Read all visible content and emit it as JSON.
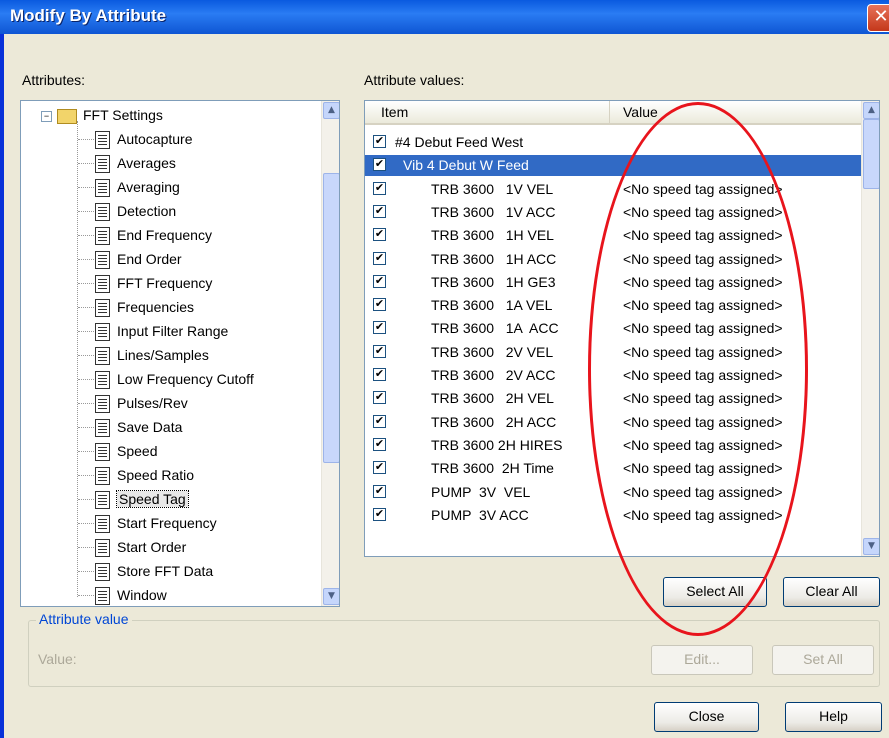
{
  "window": {
    "title": "Modify By Attribute",
    "close_glyph": "✕"
  },
  "labels": {
    "attributes": "Attributes:",
    "attribute_values": "Attribute values:"
  },
  "tree": {
    "root": "FFT Settings",
    "items": [
      "Autocapture",
      "Averages",
      "Averaging",
      "Detection",
      "End Frequency",
      "End Order",
      "FFT Frequency",
      "Frequencies",
      "Input Filter Range",
      "Lines/Samples",
      "Low Frequency Cutoff",
      "Pulses/Rev",
      "Save Data",
      "Speed",
      "Speed Ratio",
      "Speed Tag",
      "Start Frequency",
      "Start Order",
      "Store FFT Data",
      "Window"
    ],
    "selected": "Speed Tag"
  },
  "list": {
    "columns": {
      "item": "Item",
      "value": "Value"
    },
    "rows": [
      {
        "item": "#4 Debut Feed West",
        "value": "",
        "indent": 0
      },
      {
        "item": "Vib 4 Debut W Feed",
        "value": "",
        "indent": 1,
        "highlighted": true
      },
      {
        "item": "TRB 3600   1V VEL",
        "value": "<No speed tag assigned>",
        "indent": 2
      },
      {
        "item": "TRB 3600   1V ACC",
        "value": "<No speed tag assigned>",
        "indent": 2
      },
      {
        "item": "TRB 3600   1H VEL",
        "value": "<No speed tag assigned>",
        "indent": 2
      },
      {
        "item": "TRB 3600   1H ACC",
        "value": "<No speed tag assigned>",
        "indent": 2
      },
      {
        "item": "TRB 3600   1H GE3",
        "value": "<No speed tag assigned>",
        "indent": 2
      },
      {
        "item": "TRB 3600   1A VEL",
        "value": "<No speed tag assigned>",
        "indent": 2
      },
      {
        "item": "TRB 3600   1A  ACC",
        "value": "<No speed tag assigned>",
        "indent": 2
      },
      {
        "item": "TRB 3600   2V VEL",
        "value": "<No speed tag assigned>",
        "indent": 2
      },
      {
        "item": "TRB 3600   2V ACC",
        "value": "<No speed tag assigned>",
        "indent": 2
      },
      {
        "item": "TRB 3600   2H VEL",
        "value": "<No speed tag assigned>",
        "indent": 2
      },
      {
        "item": "TRB 3600   2H ACC",
        "value": "<No speed tag assigned>",
        "indent": 2
      },
      {
        "item": "TRB 3600 2H HIRES",
        "value": "<No speed tag assigned>",
        "indent": 2
      },
      {
        "item": "TRB 3600  2H Time",
        "value": "<No speed tag assigned>",
        "indent": 2
      },
      {
        "item": "PUMP  3V  VEL",
        "value": "<No speed tag assigned>",
        "indent": 2
      },
      {
        "item": "PUMP  3V ACC",
        "value": "<No speed tag assigned>",
        "indent": 2
      }
    ],
    "check_glyph": "✔"
  },
  "buttons": {
    "select_all": "Select All",
    "clear_all": "Clear All",
    "edit": "Edit...",
    "set_all": "Set All",
    "close": "Close",
    "help": "Help"
  },
  "attribute_value": {
    "group_label": "Attribute value",
    "value_label": "Value:"
  },
  "colors": {
    "title_bar": "#0a5adf",
    "selection": "#316ac5",
    "annotation_ellipse": "#e8141c"
  }
}
